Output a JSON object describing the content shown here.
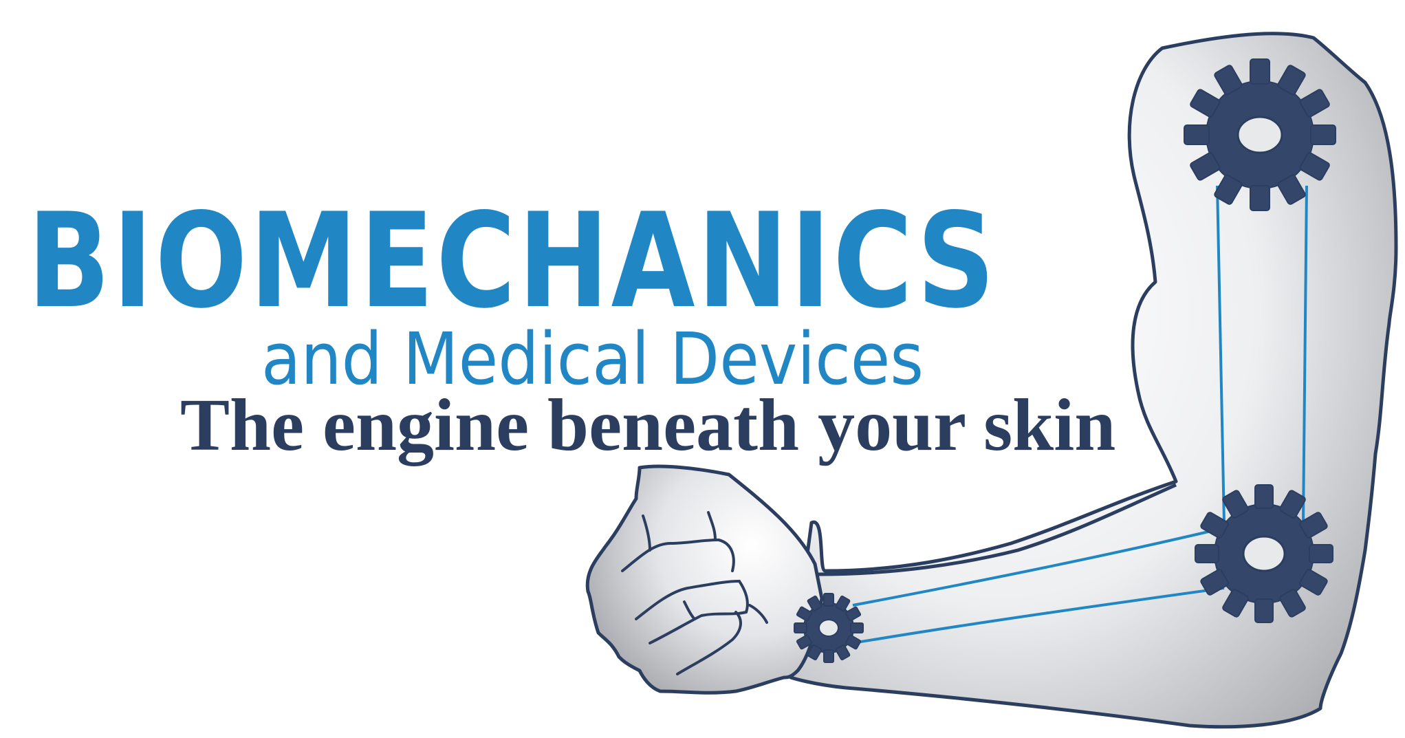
{
  "logo": {
    "title": "BIOMECHANICS",
    "subtitle": "and Medical Devices",
    "tagline": "The engine beneath your skin"
  },
  "colors": {
    "title_blue": "#2186c4",
    "navy": "#2b3e60",
    "gear": "#34466a",
    "outline": "#2b3e60",
    "tendon": "#2186c4"
  },
  "icons": {
    "arm": "mechanical-arm-illustration",
    "gears": [
      "shoulder-gear-icon",
      "elbow-gear-icon",
      "wrist-gear-icon"
    ]
  }
}
